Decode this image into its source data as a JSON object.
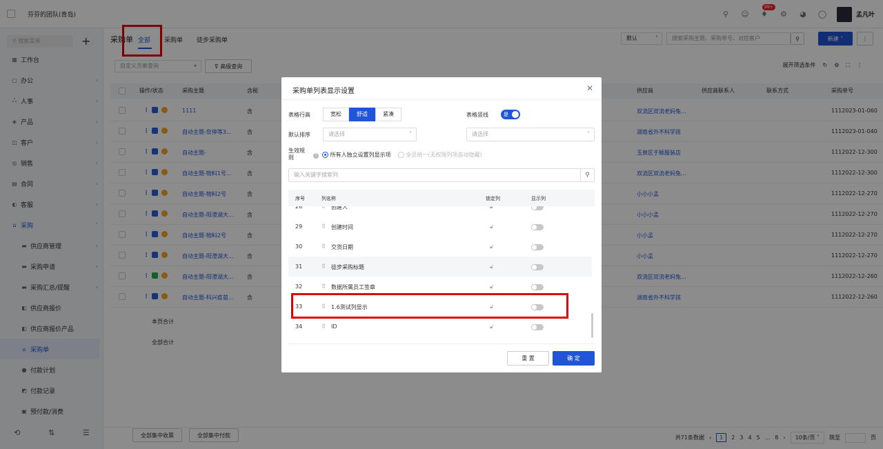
{
  "topbar": {
    "team": "芬芬的团队(青岛)",
    "badge": "99+",
    "user": "孟凡叶"
  },
  "sidebar": {
    "search_placeholder": "搜索菜单",
    "items": [
      {
        "label": "工作台",
        "icon": "grid-icon"
      },
      {
        "label": "办公",
        "icon": "office-icon"
      },
      {
        "label": "人事",
        "icon": "people-icon"
      },
      {
        "label": "产品",
        "icon": "product-icon"
      },
      {
        "label": "客户",
        "icon": "customer-icon"
      },
      {
        "label": "销售",
        "icon": "sales-icon"
      },
      {
        "label": "合同",
        "icon": "contract-icon"
      },
      {
        "label": "客服",
        "icon": "service-icon"
      },
      {
        "label": "采购",
        "icon": "purchase-icon"
      }
    ],
    "subitems": [
      {
        "label": "供应商管理"
      },
      {
        "label": "采购申请"
      },
      {
        "label": "采购汇总/提醒"
      },
      {
        "label": "供应商报价"
      },
      {
        "label": "供应商报价产品"
      },
      {
        "label": "采购单"
      },
      {
        "label": "付款计划"
      },
      {
        "label": "付款记录"
      },
      {
        "label": "预付款/消费"
      }
    ]
  },
  "main": {
    "title": "采购单",
    "tabs": [
      "全部",
      "采购单",
      "徒步采购单"
    ],
    "scheme_placeholder": "自定义方案查询",
    "advanced": "高级查询",
    "sort_default": "默认",
    "search_placeholder": "搜索采购主题、采购单号、对应客户",
    "new_btn": "新建",
    "expand_filter": "展开筛选条件",
    "columns": [
      "操作/状态",
      "采购主题",
      "含税",
      "供应商",
      "供应商联系人",
      "联系方式",
      "采购单号"
    ],
    "rows": [
      {
        "subject": "1111",
        "tax": "含",
        "supplier": "双流区双流老妈兔...",
        "no": "1112023-01-060",
        "green": false
      },
      {
        "subject": "自动主题-您停等3...",
        "tax": "含",
        "supplier": "湖南省外不科学孩",
        "no": "1112023-01-040",
        "green": false
      },
      {
        "subject": "自动主题-",
        "tax": "含",
        "supplier": "玉泉区于颖服装店",
        "no": "1112022-12-300",
        "green": false
      },
      {
        "subject": "自动主题-物料1号...",
        "tax": "含",
        "supplier": "双流区双流老妈兔...",
        "no": "1112022-12-300",
        "green": false
      },
      {
        "subject": "自动主题-物料2号",
        "tax": "含",
        "supplier": "小小小孟",
        "no": "1112022-12-270",
        "green": false
      },
      {
        "subject": "自动主题-阳澄湖大...",
        "tax": "含",
        "supplier": "小小小孟",
        "no": "1112022-12-270",
        "green": false
      },
      {
        "subject": "自动主题-物料2号",
        "tax": "含",
        "supplier": "小小孟",
        "no": "1112022-12-270",
        "green": false
      },
      {
        "subject": "自动主题-阳澄湖大...",
        "tax": "含",
        "supplier": "小小孟",
        "no": "1112022-12-270",
        "green": false
      },
      {
        "subject": "自动主题-阳澄湖大...",
        "tax": "含",
        "supplier": "双流区双流老妈兔...",
        "no": "1112022-12-260",
        "green": true
      },
      {
        "subject": "自动主题-科兴疫苗...",
        "tax": "含",
        "supplier": "湖南省外不科学孩",
        "no": "1112022-12-260",
        "green": false
      }
    ],
    "page_total": "本页合计",
    "all_total": "全部合计",
    "footer_btn1": "全部集中收票",
    "footer_btn2": "全部集中付款",
    "pager": {
      "total": "共71条数据",
      "pages": [
        "1",
        "2",
        "3",
        "4",
        "5",
        "...",
        "8"
      ],
      "size": "10条/页",
      "jump": "跳至",
      "page_unit": "页"
    }
  },
  "modal": {
    "title": "采购单列表显示设置",
    "row_height_label": "表格行高",
    "row_heights": [
      "宽松",
      "舒适",
      "紧凑"
    ],
    "border_label": "表格竖线",
    "border_toggle": "是",
    "sort_label": "默认排序",
    "select_placeholder": "请选择",
    "rule_label": "生效规则",
    "rule_opt1": "所有人独立设置列显示项",
    "rule_opt2": "全员统一(无权限列项自动隐藏)",
    "search_placeholder": "输入关键字搜索列",
    "cols": [
      "序号",
      "列名称",
      "锁定列",
      "显示列"
    ],
    "rows": [
      {
        "no": "28",
        "name": "创建人"
      },
      {
        "no": "29",
        "name": "创建时间"
      },
      {
        "no": "30",
        "name": "交货日期"
      },
      {
        "no": "31",
        "name": "徒步采购标题"
      },
      {
        "no": "32",
        "name": "数据所属员工签章"
      },
      {
        "no": "33",
        "name": "1.6测试列显示"
      },
      {
        "no": "34",
        "name": "ID"
      }
    ],
    "reset": "重 置",
    "ok": "确 定"
  },
  "colors": {
    "primary": "#1f55d6",
    "highlight": "#e00000"
  }
}
